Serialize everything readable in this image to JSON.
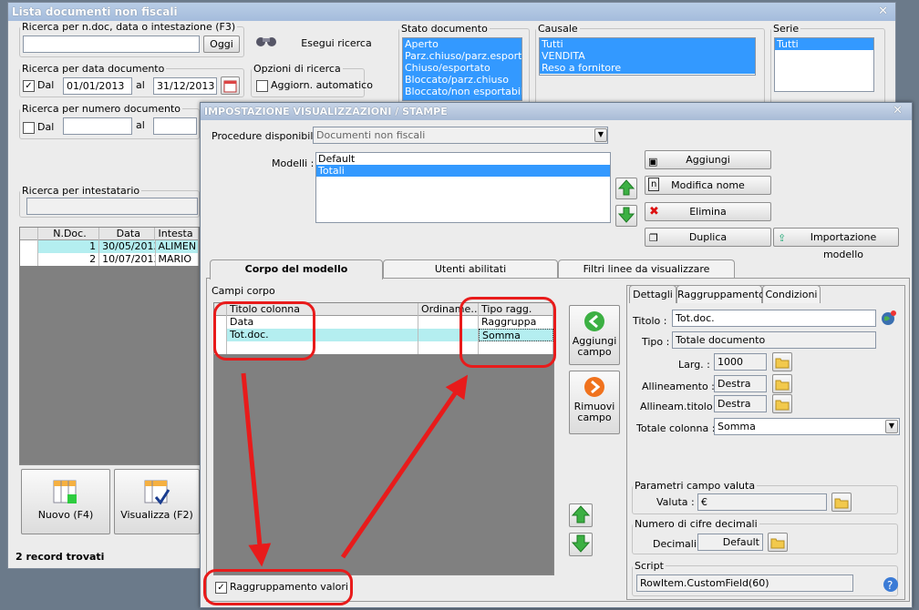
{
  "main_window": {
    "title": "Lista documenti non fiscali",
    "close": "✕",
    "search_doc": {
      "label": "Ricerca per n.doc, data o intestazione (F3)",
      "value": "",
      "button": "Oggi"
    },
    "search_btn": "Esegui ricerca",
    "date_search": {
      "label": "Ricerca per data documento",
      "from_label": "Dal",
      "from": "01/01/2013",
      "al": "al",
      "to": "31/12/2013"
    },
    "options": {
      "label": "Opzioni di ricerca",
      "auto": "Aggiorn. automatico"
    },
    "stato": {
      "label": "Stato documento",
      "items": [
        "Aperto",
        "Parz.chiuso/parz.esportato",
        "Chiuso/esportato",
        "Bloccato/parz.chiuso",
        "Bloccato/non esportabile"
      ]
    },
    "causale": {
      "label": "Causale",
      "items": [
        "Tutti",
        "VENDITA",
        "Reso a fornitore"
      ]
    },
    "serie": {
      "label": "Serie",
      "items": [
        "Tutti"
      ]
    },
    "num_search": {
      "label": "Ricerca per numero documento",
      "from_label": "Dal",
      "al": "al"
    },
    "holder_search": {
      "label": "Ricerca per intestatario"
    },
    "table": {
      "headers": [
        "N.Doc.",
        "Data",
        "Intesta"
      ],
      "rows": [
        [
          "1",
          "30/05/2013",
          "ALIMEN"
        ],
        [
          "2",
          "10/07/2013",
          "MARIO"
        ]
      ]
    },
    "btn_new": "Nuovo (F4)",
    "btn_view": "Visualizza (F2)",
    "status": "2 record trovati"
  },
  "dialog": {
    "title": "IMPOSTAZIONE VISUALIZZAZIONI / STAMPE",
    "close": "✕",
    "procedure_label": "Procedure disponibili :",
    "procedure_value": "Documenti non fiscali",
    "models_label": "Modelli :",
    "models": [
      "Default",
      "Totali"
    ],
    "btn_add": "Aggiungi",
    "btn_rename": "Modifica nome",
    "btn_delete": "Elimina",
    "btn_dup": "Duplica",
    "btn_import": "Importazione modello",
    "tabs": [
      "Corpo del modello",
      "Utenti abilitati",
      "Filtri linee da visualizzare"
    ],
    "campi_label": "Campi corpo",
    "grid": {
      "headers": [
        "Titolo colonna",
        "Ordiname…",
        "Tipo ragg."
      ],
      "rows": [
        [
          "Data",
          "",
          "Raggruppa"
        ],
        [
          "Tot.doc.",
          "",
          "Somma"
        ]
      ]
    },
    "add_field": "Aggiungi campo",
    "remove_field": "Rimuovi campo",
    "group_values": "Raggruppamento valori",
    "sub_tabs": [
      "Dettagli",
      "Raggruppamento",
      "Condizioni"
    ],
    "details": {
      "titolo_label": "Titolo :",
      "titolo": "Tot.doc.",
      "tipo_label": "Tipo :",
      "tipo": "Totale documento",
      "larg_label": "Larg. :",
      "larg": "1000",
      "allin_label": "Allineamento :",
      "allin": "Destra",
      "allint_label": "Allineam.titolo :",
      "allint": "Destra",
      "totcol_label": "Totale colonna :",
      "totcol": "Somma",
      "valuta_group": "Parametri campo valuta",
      "valuta_label": "Valuta :",
      "valuta": "€",
      "dec_group": "Numero di cifre decimali",
      "dec_label": "Decimali :",
      "dec": "Default",
      "script_group": "Script",
      "script": "RowItem.CustomField(60)"
    }
  },
  "colors": {
    "annotation": "#e81b1b",
    "selection": "#3399ff",
    "highlight_row": "#b4eef0"
  }
}
